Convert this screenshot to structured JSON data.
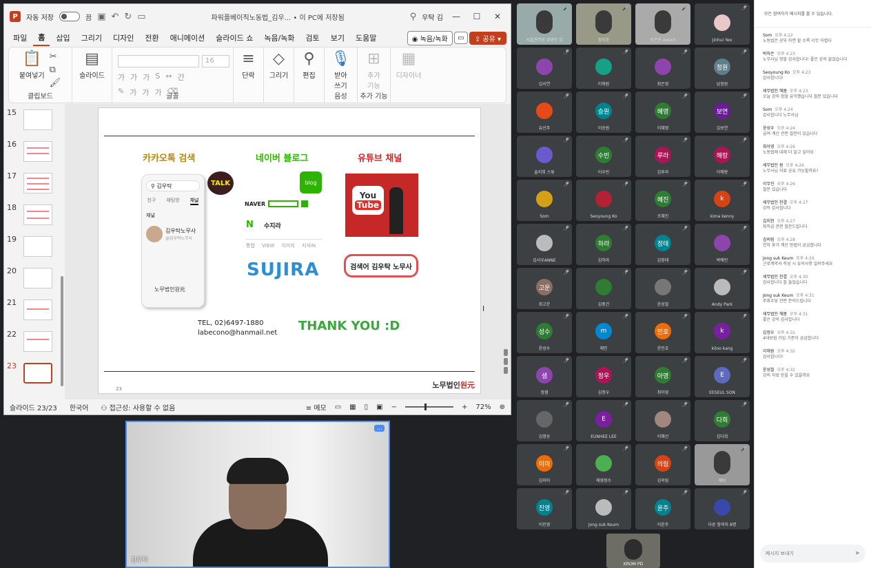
{
  "ppt": {
    "autosave_label": "자동 저장",
    "autosave_state": "끔",
    "doc_title": "파워플베이직노동법_김우... • 이 PC에 저장됨",
    "user_name": "우탁 김",
    "tabs": [
      "파일",
      "홈",
      "삽입",
      "그리기",
      "디자인",
      "전환",
      "애니메이션",
      "슬라이드 쇼",
      "녹음/녹화",
      "검토",
      "보기",
      "도움말"
    ],
    "record_button": "녹음/녹화",
    "share_button": "공유",
    "ribbon": {
      "paste": "붙여넣기",
      "clipboard": "클립보드",
      "slide": "슬라이드",
      "font_size": "16",
      "font_group": "글꼴",
      "paragraph": "단락",
      "drawing": "그리기",
      "editing": "편집",
      "dictate": "받아\n쓰기",
      "voice_group": "음성",
      "addins": "추가\n기능",
      "addins_group": "추가 기능",
      "designer": "디자이너"
    },
    "thumb_numbers": [
      "15",
      "16",
      "17",
      "18",
      "19",
      "20",
      "21",
      "22",
      "23"
    ],
    "slide": {
      "h1": "카카오톡 검색",
      "h2": "네이버 블로그",
      "h3": "유튜브 채널",
      "phone_search": "김우탁",
      "phone_tabs": [
        "친구",
        "채팅방",
        "채널"
      ],
      "phone_section": "채널",
      "phone_profile": "김우탁노무사",
      "phone_sub": "@김우탁노무사",
      "phone_logo": "노무법인원元",
      "talk": "TALK",
      "blog": "blog",
      "naver": "NAVER",
      "naver_n": "N",
      "naver_name": "수지라",
      "naver_tabs": "통합 VIEW 이미지 지식iN",
      "sujira": "SUJIRA",
      "yt_you": "You",
      "yt_tube": "Tube",
      "pill": "검색어 김우탁 노무사",
      "tel": "TEL, 02)6497-1880",
      "email": "labecono@hanmail.net",
      "thanks": "THANK YOU :D",
      "slide_num": "23",
      "logo_a": "노무법인",
      "logo_b": "원元"
    },
    "status": {
      "slide_pos": "슬라이드 23/23",
      "lang": "한국어",
      "access": "접근성: 사용할 수 없음",
      "memo": "메모",
      "zoom": "72%"
    }
  },
  "main_cam": {
    "name": "김우탁",
    "menu": "..."
  },
  "grid": [
    {
      "name": "서울권역원 경영인 김",
      "type": "video",
      "color": "#9aa"
    },
    {
      "name": "정지윤",
      "type": "video",
      "color": "#998"
    },
    {
      "name": "조은진 owoch",
      "type": "video",
      "color": "#aaa"
    },
    {
      "name": "Jinhui Yeo",
      "initial": "",
      "color": "#e8c8c8"
    },
    {
      "name": "김서연",
      "initial": "",
      "color": "#8e44ad"
    },
    {
      "name": "이해원",
      "initial": "",
      "color": "#16a085"
    },
    {
      "name": "최은영",
      "initial": "",
      "color": "#8e44ad"
    },
    {
      "name": "남정원",
      "initial": "정원",
      "color": "#607d8b"
    },
    {
      "name": "유선주",
      "initial": "",
      "color": "#e64a19"
    },
    {
      "name": "이승원",
      "initial": "승원",
      "color": "#00838f"
    },
    {
      "name": "이혜영",
      "initial": "혜영",
      "color": "#2e7d32"
    },
    {
      "name": "김보연",
      "initial": "보연",
      "color": "#6a1b9a"
    },
    {
      "name": "솔지희 스튜",
      "initial": "",
      "color": "#6a5acd"
    },
    {
      "name": "이수빈",
      "initial": "수빈",
      "color": "#2e7d32"
    },
    {
      "name": "김루라",
      "initial": "루라",
      "color": "#ad1457"
    },
    {
      "name": "이해랑",
      "initial": "해랑",
      "color": "#ad1457"
    },
    {
      "name": "Som",
      "initial": "",
      "color": "#d4a017"
    },
    {
      "name": "Seoyoung Ko",
      "initial": "",
      "color": "#b22234"
    },
    {
      "name": "조혜진",
      "initial": "혜진",
      "color": "#2e7d32"
    },
    {
      "name": "kima kenny",
      "initial": "k",
      "color": "#d84315"
    },
    {
      "name": "김서우ANNE",
      "initial": "",
      "color": "#bbb"
    },
    {
      "name": "김하라",
      "initial": "하라",
      "color": "#2e7d32"
    },
    {
      "name": "김정태",
      "initial": "정태",
      "color": "#00838f"
    },
    {
      "name": "박예인",
      "initial": "",
      "color": "#8e44ad"
    },
    {
      "name": "최고운",
      "initial": "고운",
      "color": "#8d6e63"
    },
    {
      "name": "김중건",
      "initial": "",
      "color": "#2e7d32"
    },
    {
      "name": "윤성철",
      "initial": "",
      "color": "#777"
    },
    {
      "name": "Andy Park",
      "initial": "",
      "color": "#bbb"
    },
    {
      "name": "윤성수",
      "initial": "성수",
      "color": "#2e7d32"
    },
    {
      "name": "채민",
      "initial": "m",
      "color": "#0288d1"
    },
    {
      "name": "윤민호",
      "initial": "민호",
      "color": "#ef6c00"
    },
    {
      "name": "kiloo kang",
      "initial": "k",
      "color": "#7b1fa2"
    },
    {
      "name": "정샘",
      "initial": "샘",
      "color": "#8e44ad"
    },
    {
      "name": "김정우",
      "initial": "정우",
      "color": "#ad1457"
    },
    {
      "name": "최아영",
      "initial": "아영",
      "color": "#2e7d32"
    },
    {
      "name": "EESEUL SON",
      "initial": "E",
      "color": "#5c6bc0"
    },
    {
      "name": "김영송",
      "initial": "",
      "color": "#666"
    },
    {
      "name": "EUNHEE LEE",
      "initial": "E",
      "color": "#7b1fa2"
    },
    {
      "name": "이혜선",
      "initial": "",
      "color": "#a1887f"
    },
    {
      "name": "김다희",
      "initial": "다희",
      "color": "#2e7d32"
    },
    {
      "name": "김미미",
      "initial": "미미",
      "color": "#ef6c00"
    },
    {
      "name": "해영정수",
      "initial": "",
      "color": "#4caf50"
    },
    {
      "name": "김의림",
      "initial": "의림",
      "color": "#d84315"
    },
    {
      "name": "채바",
      "type": "video",
      "color": "#999"
    },
    {
      "name": "이진영",
      "initial": "진영",
      "color": "#00838f"
    },
    {
      "name": "Jong suk Keum",
      "initial": "",
      "color": "#bbb"
    },
    {
      "name": "이윤주",
      "initial": "윤주",
      "color": "#00838f"
    },
    {
      "name": "다른 참여자 8명",
      "initial": "",
      "color": "#3949ab"
    }
  ],
  "self_cam": {
    "name": "KROM PD"
  },
  "chat": {
    "header": "모든 참여자가 메시지를 볼 수 있습니다.",
    "messages": [
      {
        "author": "Som",
        "time": "오후 4:22",
        "text": "노동법은 공부 하면 할 수록 너무 어렵다"
      },
      {
        "author": "박하은",
        "time": "오후 4:23",
        "text": "노무사님 정말 감사합니다! 좋은 강의 들었습니다"
      },
      {
        "author": "Seoyoung Ko",
        "time": "오후 4:23",
        "text": "감사합니다!"
      },
      {
        "author": "세무법인 해봄",
        "time": "오후 4:23",
        "text": "오늘 강의 정말 유익했습니다 질문 있습니다"
      },
      {
        "author": "Som",
        "time": "오후 4:24",
        "text": "감사합니다 노무사님"
      },
      {
        "author": "윤성수",
        "time": "오후 4:24",
        "text": "급여 계산 관련 질문이 있습니다"
      },
      {
        "author": "최아영",
        "time": "오후 4:26",
        "text": "노동법에 대해 더 알고 싶어요"
      },
      {
        "author": "세무법인 원",
        "time": "오후 4:26",
        "text": "노무사님 자료 공유 가능할까요?"
      },
      {
        "author": "이무진",
        "time": "오후 4:26",
        "text": "질문 있습니다"
      },
      {
        "author": "세무법인 한결",
        "time": "오후 4:27",
        "text": "강의 감사합니다"
      },
      {
        "author": "김지현",
        "time": "오후 4:27",
        "text": "퇴직금 관련 질문드립니다"
      },
      {
        "author": "김의림",
        "time": "오후 4:28",
        "text": "연차 휴가 계산 방법이 궁금합니다"
      },
      {
        "author": "Jong suk Keum",
        "time": "오후 4:29",
        "text": "근로계약서 작성 시 유의사항 알려주세요"
      },
      {
        "author": "세무법인 한결",
        "time": "오후 4:30",
        "text": "감사합니다 잘 들었습니다"
      },
      {
        "author": "Jong suk Keum",
        "time": "오후 4:31",
        "text": "주휴수당 관련 문의드립니다"
      },
      {
        "author": "세무법인 해봄",
        "time": "오후 4:31",
        "text": "좋은 강의 감사합니다"
      },
      {
        "author": "김정우",
        "time": "오후 4:31",
        "text": "4대보험 가입 기준이 궁금합니다"
      },
      {
        "author": "이해원",
        "time": "오후 4:32",
        "text": "감사합니다!"
      },
      {
        "author": "윤성철",
        "time": "오후 4:32",
        "text": "강의 자료 받을 수 있을까요"
      }
    ],
    "input_placeholder": "메시지 보내기"
  }
}
